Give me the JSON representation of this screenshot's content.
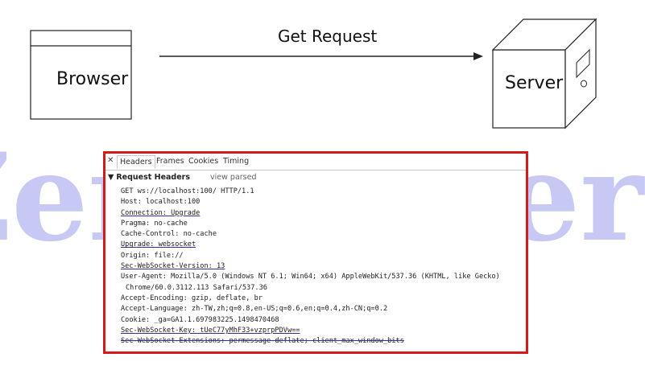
{
  "diagram": {
    "browser_label": "Browser",
    "arrow_label": "Get Request",
    "server_label": "Server",
    "watermark": "ZeroToHero"
  },
  "devtools": {
    "tabs": [
      "Headers",
      "Frames",
      "Cookies",
      "Timing"
    ],
    "section_title": "Request Headers",
    "view_parsed": "view parsed",
    "lines": [
      "GET ws://localhost:100/ HTTP/1.1",
      "Host: localhost:100",
      "Connection: Upgrade",
      "Pragma: no-cache",
      "Cache-Control: no-cache",
      "Upgrade: websocket",
      "Origin: file://",
      "Sec-WebSocket-Version: 13",
      "User-Agent: Mozilla/5.0 (Windows NT 6.1; Win64; x64) AppleWebKit/537.36 (KHTML, like Gecko)",
      "Chrome/60.0.3112.113 Safari/537.36",
      "Accept-Encoding: gzip, deflate, br",
      "Accept-Language: zh-TW,zh;q=0.8,en-US;q=0.6,en;q=0.4,zh-CN;q=0.2",
      "Cookie: _ga=GA1.1.697983225.1498470468",
      "Sec-WebSocket-Key: tUeC77yMhF33+vzprpPDVw==",
      "Sec-WebSocket-Extensions: permessage-deflate; client_max_window_bits"
    ]
  },
  "colors": {
    "highlight_border": "#d41a1a",
    "watermark": "#3b3bd6",
    "underline": "#3030a0"
  }
}
